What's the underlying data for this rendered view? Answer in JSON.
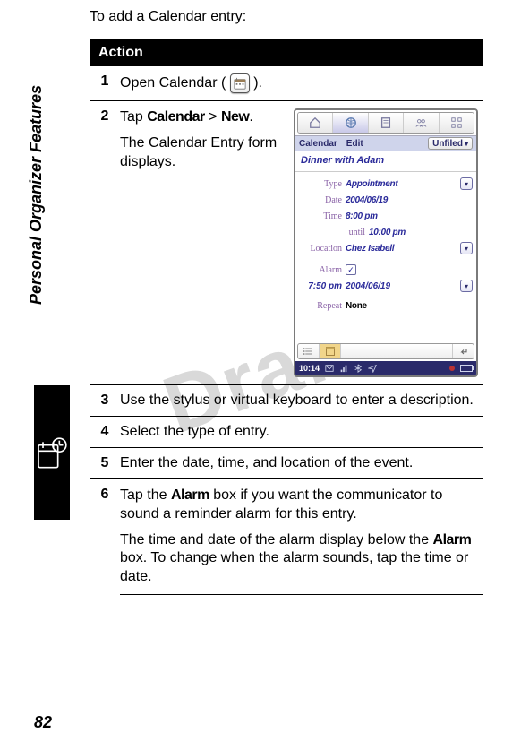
{
  "page_number": "82",
  "sidebar_label": "Personal Organizer Features",
  "watermark": "Draft",
  "intro": "To add a Calendar entry:",
  "table_header": "Action",
  "steps": {
    "s1": {
      "num": "1",
      "text_a": "Open Calendar (",
      "text_b": ")."
    },
    "s2": {
      "num": "2",
      "line1_a": "Tap ",
      "line1_b": "Calendar",
      "line1_c": " > ",
      "line1_d": " New",
      "line1_e": ".",
      "line2": "The Calendar Entry form displays."
    },
    "s3": {
      "num": "3",
      "text": "Use the stylus or virtual keyboard to enter a description."
    },
    "s4": {
      "num": "4",
      "text": "Select the type of entry."
    },
    "s5": {
      "num": "5",
      "text": "Enter the date, time, and location of the event."
    },
    "s6": {
      "num": "6",
      "p1_a": "Tap the ",
      "p1_b": "Alarm",
      "p1_c": " box if you want the communicator to sound a reminder alarm for this entry.",
      "p2_a": "The time and date of the alarm display below the ",
      "p2_b": "Alarm",
      "p2_c": " box. To change when the alarm sounds, tap the time or date."
    }
  },
  "phone": {
    "menubar": {
      "calendar": "Calendar",
      "edit": "Edit",
      "unfiled": "Unfiled"
    },
    "description": "Dinner with Adam",
    "labels": {
      "type": "Type",
      "date": "Date",
      "time": "Time",
      "until": "until",
      "location": "Location",
      "alarm": "Alarm",
      "repeat": "Repeat"
    },
    "values": {
      "type": "Appointment",
      "date": "2004/06/19",
      "time": "8:00 pm",
      "until": "10:00 pm",
      "location": "Chez Isabell",
      "alarm_checked": "✓",
      "alarm_time": "7:50 pm",
      "alarm_date": "2004/06/19",
      "repeat": "None"
    },
    "status_time": "10:14"
  }
}
